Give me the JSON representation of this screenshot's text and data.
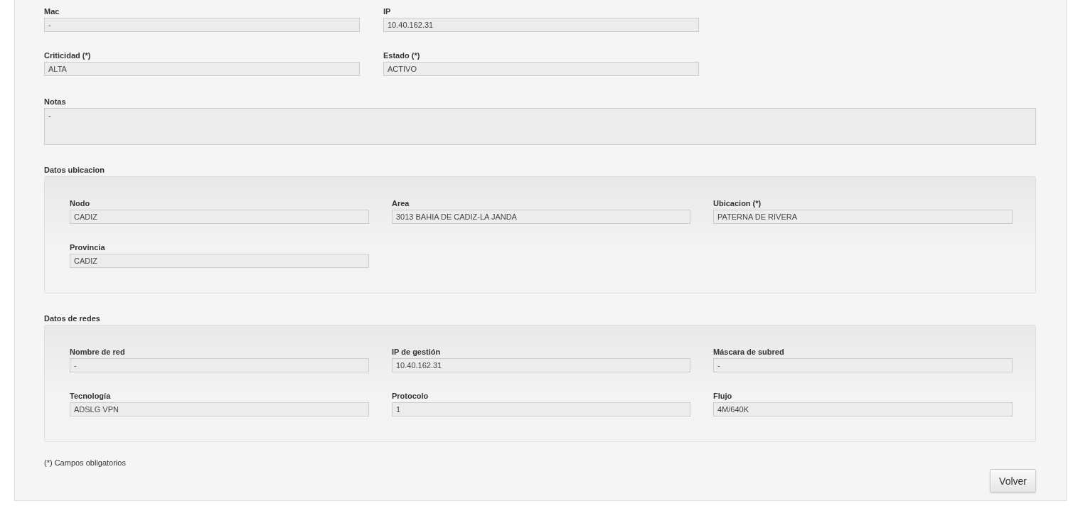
{
  "fields": [
    {
      "label": "Mac",
      "value": "-"
    },
    {
      "label": "IP",
      "value": "10.40.162.31"
    },
    {
      "label": "Criticidad (*)",
      "value": "ALTA"
    },
    {
      "label": "Estado (*)",
      "value": "ACTIVO"
    }
  ],
  "notes": {
    "label": "Notas",
    "value": "-"
  },
  "sections": [
    {
      "title": "Datos ubicacion",
      "fields": [
        {
          "label": "Nodo",
          "value": "CADIZ"
        },
        {
          "label": "Area",
          "value": "3013 BAHIA DE CADIZ-LA JANDA"
        },
        {
          "label": "Ubicacion (*)",
          "value": "PATERNA DE RIVERA"
        },
        {
          "label": "Provincia",
          "value": "CADIZ"
        }
      ]
    },
    {
      "title": "Datos de redes",
      "fields": [
        {
          "label": "Nombre de red",
          "value": "-"
        },
        {
          "label": "IP de gestión",
          "value": "10.40.162.31"
        },
        {
          "label": "Máscara de subred",
          "value": "-"
        },
        {
          "label": "Tecnología",
          "value": "ADSLG VPN"
        },
        {
          "label": "Protocolo",
          "value": "1"
        },
        {
          "label": "Flujo",
          "value": "4M/640K"
        }
      ]
    }
  ],
  "footnote": "(*) Campos obligatorios",
  "buttons": [
    "Volver"
  ]
}
